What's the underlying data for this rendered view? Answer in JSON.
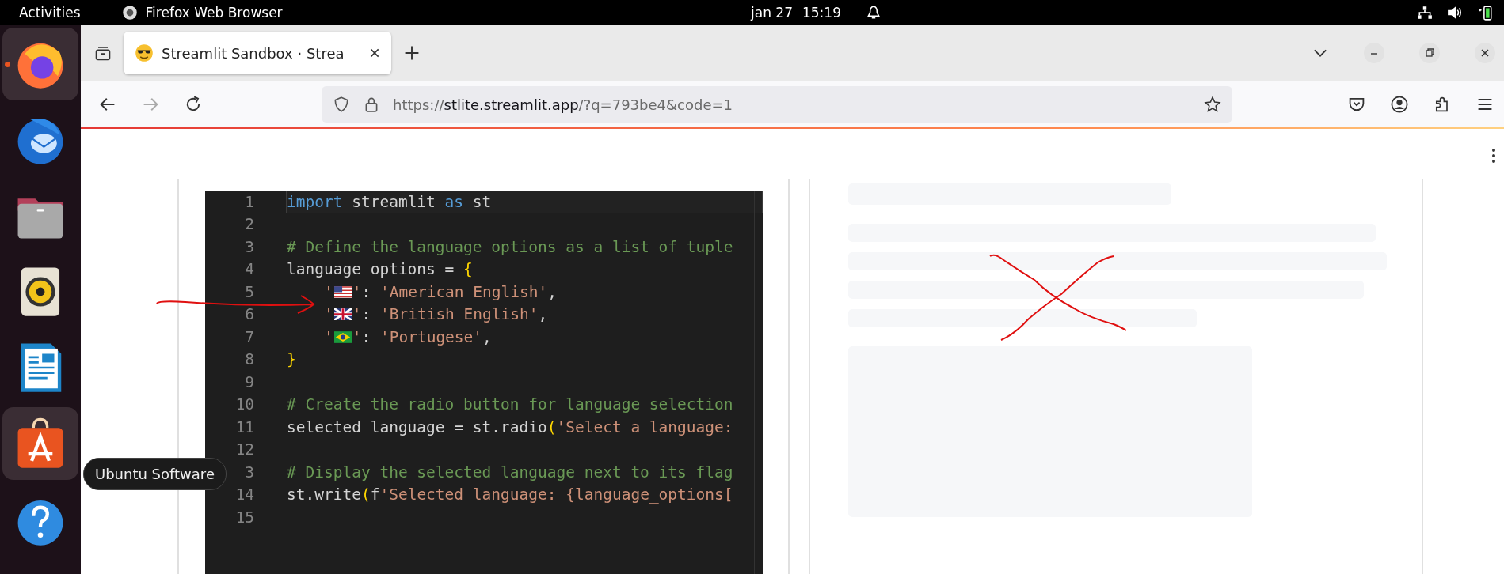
{
  "top_bar": {
    "activities": "Activities",
    "app_name": "Firefox Web Browser",
    "date": "jan 27",
    "time": "15:19"
  },
  "dock": {
    "items": [
      {
        "kind": "firefox",
        "running": true,
        "highlighted": true
      },
      {
        "kind": "thunderbird",
        "running": false,
        "highlighted": false
      },
      {
        "kind": "files",
        "running": false,
        "highlighted": false
      },
      {
        "kind": "speaker",
        "running": false,
        "highlighted": false
      },
      {
        "kind": "writer",
        "running": false,
        "highlighted": false
      },
      {
        "kind": "store",
        "running": false,
        "highlighted": true
      },
      {
        "kind": "help",
        "running": false,
        "highlighted": false
      }
    ],
    "tooltip": "Ubuntu Software"
  },
  "browser": {
    "tabs": [
      {
        "title": "Streamlit Sandbox · Strea",
        "selected": true
      }
    ],
    "url": {
      "scheme": "https://",
      "host": "stlite.streamlit.app",
      "path": "/?q=793be4&code=1"
    }
  },
  "editor": {
    "lines": [
      {
        "number": "1",
        "current": true,
        "tokens": [
          {
            "kind": "kw",
            "text": "import"
          },
          {
            "kind": "text",
            "text": " streamlit "
          },
          {
            "kind": "kw",
            "text": "as"
          },
          {
            "kind": "text",
            "text": " st"
          }
        ]
      },
      {
        "number": "2",
        "current": false
      },
      {
        "number": "3",
        "current": false,
        "tokens": [
          {
            "kind": "comment",
            "text": "# Define the language options as a list of tuple"
          }
        ]
      },
      {
        "number": "4",
        "current": false,
        "tokens": [
          {
            "kind": "text",
            "text": "language_options = "
          },
          {
            "kind": "brace",
            "text": "{"
          }
        ]
      },
      {
        "number": "5",
        "current": false,
        "indented": true,
        "tokens": [
          {
            "kind": "str",
            "text": "'"
          },
          {
            "kind": "usflag"
          },
          {
            "kind": "str",
            "text": "'"
          },
          {
            "kind": "text",
            "text": ": "
          },
          {
            "kind": "str",
            "text": "'American English'"
          },
          {
            "kind": "text",
            "text": ","
          }
        ]
      },
      {
        "number": "6",
        "current": false,
        "indented": true,
        "tokens": [
          {
            "kind": "str",
            "text": "'"
          },
          {
            "kind": "ukflag"
          },
          {
            "kind": "str",
            "text": "'"
          },
          {
            "kind": "text",
            "text": ": "
          },
          {
            "kind": "str",
            "text": "'British English'"
          },
          {
            "kind": "text",
            "text": ","
          }
        ]
      },
      {
        "number": "7",
        "current": false,
        "indented": true,
        "tokens": [
          {
            "kind": "str",
            "text": "'"
          },
          {
            "kind": "brflag"
          },
          {
            "kind": "str",
            "text": "'"
          },
          {
            "kind": "text",
            "text": ": "
          },
          {
            "kind": "str",
            "text": "'Portugese'"
          },
          {
            "kind": "text",
            "text": ","
          }
        ]
      },
      {
        "number": "8",
        "current": false,
        "tokens": [
          {
            "kind": "brace",
            "text": "}"
          }
        ]
      },
      {
        "number": "9",
        "current": false
      },
      {
        "number": "10",
        "current": false,
        "tokens": [
          {
            "kind": "comment",
            "text": "# Create the radio button for language selection"
          }
        ]
      },
      {
        "number": "11",
        "current": false,
        "tokens": [
          {
            "kind": "text",
            "text": "selected_language = st.radio"
          },
          {
            "kind": "brace",
            "text": "("
          },
          {
            "kind": "str",
            "text": "'Select a language:"
          }
        ]
      },
      {
        "number": "12",
        "current": false
      },
      {
        "number": "3",
        "current": false,
        "tokens": [
          {
            "kind": "comment",
            "text": "# Display the selected language next to its flag"
          }
        ]
      },
      {
        "number": "14",
        "current": false,
        "tokens": [
          {
            "kind": "text",
            "text": "st.write"
          },
          {
            "kind": "brace",
            "text": "("
          },
          {
            "kind": "text",
            "text": "f"
          },
          {
            "kind": "str",
            "text": "'Selected language: {language_options["
          }
        ]
      },
      {
        "number": "15",
        "current": false
      }
    ]
  }
}
